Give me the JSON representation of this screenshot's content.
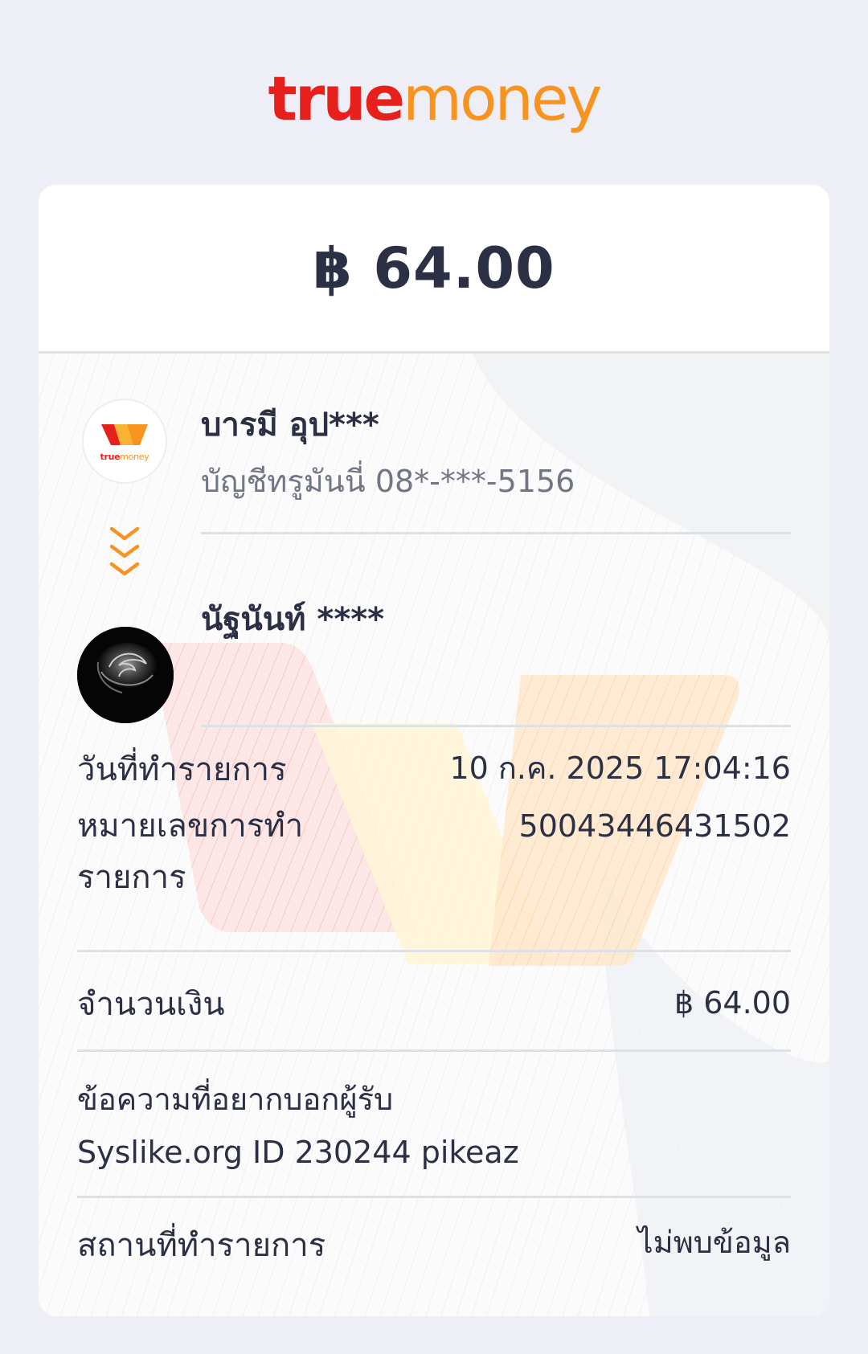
{
  "brand": {
    "logo_true": "true",
    "logo_money": "money",
    "mini_logo_true": "true",
    "mini_logo_money": "money"
  },
  "receipt": {
    "amount": "฿ 64.00",
    "sender": {
      "name": "บารมี อุป***",
      "account": "บัญชีทรูมันนี่ 08*-***-5156"
    },
    "receiver": {
      "name": "นัฐนันท์ ****"
    },
    "details": {
      "date_label": "วันที่ทำรายการ",
      "date_value": "10 ก.ค. 2025 17:04:16",
      "txn_label": "หมายเลขการทำรายการ",
      "txn_value": "50043446431502",
      "amount_label": "จำนวนเงิน",
      "amount_value": "฿ 64.00",
      "message_label": "ข้อความที่อยากบอกผู้รับ",
      "message_value": "Syslike.org ID 230244 pikeaz",
      "place_label": "สถานที่ทำรายการ",
      "place_value": "ไม่พบข้อมูล"
    }
  },
  "colors": {
    "brand_red": "#E8201C",
    "brand_orange": "#F7931E",
    "text_dark": "#2B3044",
    "text_muted": "#717684",
    "page_bg": "#EEEFF6"
  },
  "icons": {
    "sender_avatar": "truemoney-wallet-logo",
    "transfer_arrow": "double-chevron-down-icon",
    "receiver_avatar": "rose-photo-avatar"
  }
}
